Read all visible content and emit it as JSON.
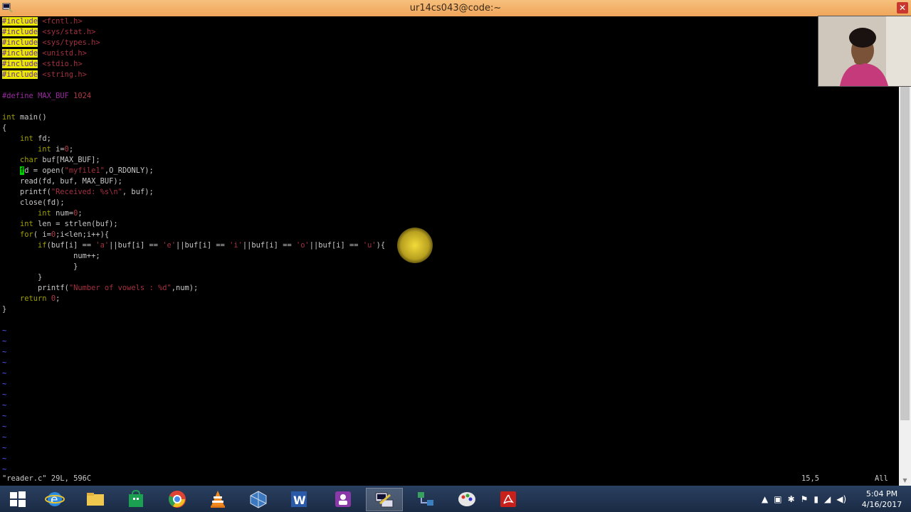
{
  "window": {
    "title": "ur14cs043@code:~"
  },
  "code": {
    "include_keyword": "#include",
    "includes": [
      "<fcntl.h>",
      "<sys/stat.h>",
      "<sys/types.h>",
      "<unistd.h>",
      "<stdio.h>",
      "<string.h>"
    ],
    "define_line": {
      "keyword": "#define",
      "name": "MAX_BUF",
      "value": "1024"
    },
    "main_signature": {
      "type": "int",
      "rest": " main()"
    },
    "open_brace": "{",
    "decl_fd": {
      "type": "int",
      "rest": " fd;"
    },
    "decl_i": {
      "type": "int",
      "rest_a": " i=",
      "value": "0",
      "rest_b": ";"
    },
    "decl_buf": {
      "type": "char",
      "rest": " buf[MAX_BUF];"
    },
    "open_call": {
      "cursor_char": "f",
      "rest_a": "d = open(",
      "string": "\"myfile1\"",
      "rest_b": ",O_RDONLY);"
    },
    "read_call": "read(fd, buf, MAX_BUF);",
    "printf_received": {
      "rest_a": "printf(",
      "string": "\"Received: %s\\n\"",
      "rest_b": ", buf);"
    },
    "close_call": "close(fd);",
    "decl_num": {
      "type": "int",
      "rest_a": " num=",
      "value": "0",
      "rest_b": ";"
    },
    "decl_len": {
      "type": "int",
      "rest": " len = strlen(buf);"
    },
    "for_loop": {
      "keyword": "for",
      "rest_a": "( i=",
      "value": "0",
      "rest_b": ";i<len;i++){"
    },
    "if_stmt": {
      "keyword": "if",
      "p1": "(buf[i] == ",
      "c1": "'a'",
      "p2": "||buf[i] == ",
      "c2": "'e'",
      "p3": "||buf[i] == ",
      "c3": "'i'",
      "p4": "||buf[i] == ",
      "c4": "'o'",
      "p5": "||buf[i] == ",
      "c5": "'u'",
      "p6": "){"
    },
    "num_inc": "num++;",
    "inner_close": "}",
    "for_close": "}",
    "printf_vowels": {
      "rest_a": "printf(",
      "string": "\"Number of vowels : %d\"",
      "rest_b": ",num);"
    },
    "return_stmt": {
      "keyword": "return",
      "rest_a": " ",
      "value": "0",
      "rest_b": ";"
    },
    "close_brace": "}",
    "tilde": "~"
  },
  "status_bar": {
    "file_info": "\"reader.c\" 29L, 596C",
    "position": "15,5",
    "scroll": "All"
  },
  "taskbar": {
    "apps": [
      "start",
      "internet-explorer",
      "file-explorer",
      "store",
      "chrome",
      "vlc",
      "virtualbox",
      "word",
      "teams",
      "putty",
      "network",
      "paint",
      "acrobat"
    ]
  },
  "clock": {
    "time": "5:04 PM",
    "date": "4/16/2017"
  },
  "colors": {
    "titlebar": "#f0a45a",
    "preprocessor_bg": "#e8e800",
    "string": "#a43040",
    "keyword": "#a0a000",
    "cursor": "#00d000",
    "tilde": "#5a5aff"
  }
}
